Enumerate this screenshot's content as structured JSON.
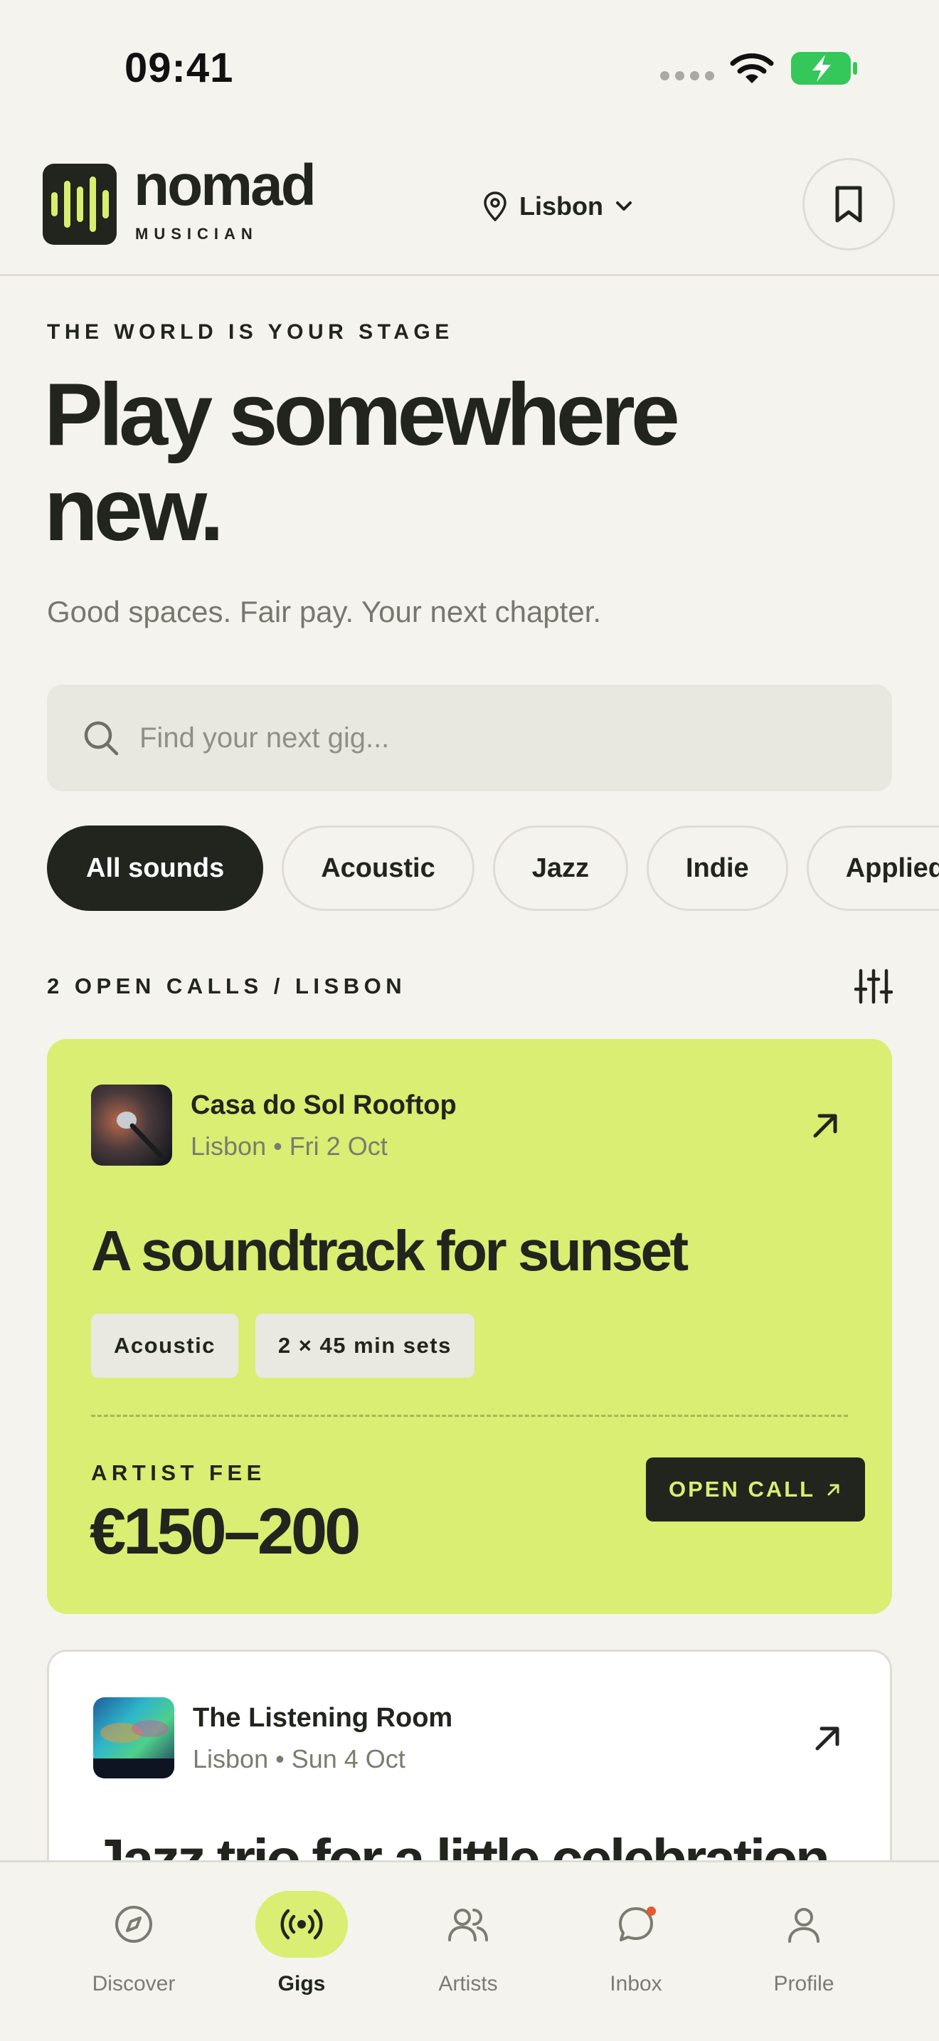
{
  "status_bar": {
    "time": "09:41"
  },
  "brand": {
    "name": "nomad",
    "subtitle": "MUSICIAN"
  },
  "location": {
    "city": "Lisbon"
  },
  "hero": {
    "eyebrow": "THE WORLD IS YOUR STAGE",
    "title": "Play somewhere new.",
    "subtitle": "Good spaces. Fair pay. Your next chapter."
  },
  "search": {
    "placeholder": "Find your next gig..."
  },
  "filters": [
    {
      "label": "All sounds",
      "active": true
    },
    {
      "label": "Acoustic",
      "active": false
    },
    {
      "label": "Jazz",
      "active": false
    },
    {
      "label": "Indie",
      "active": false
    },
    {
      "label": "Applied",
      "active": false
    }
  ],
  "list_header": "2 OPEN CALLS / LISBON",
  "gigs": [
    {
      "venue": "Casa do Sol Rooftop",
      "meta": "Lisbon • Fri 2 Oct",
      "title": "A soundtrack for sunset",
      "tags": [
        "Acoustic",
        "2 × 45 min sets"
      ],
      "fee_label": "ARTIST FEE",
      "fee": "€150–200",
      "cta": "OPEN CALL",
      "card_color": "#D9EE72"
    },
    {
      "venue": "The Listening Room",
      "meta": "Lisbon • Sun 4 Oct",
      "title": "Jazz trio for a little celebration",
      "card_color": "#FFFFFF"
    }
  ],
  "tabs": [
    {
      "label": "Discover",
      "icon": "compass-icon",
      "active": false
    },
    {
      "label": "Gigs",
      "icon": "broadcast-icon",
      "active": true
    },
    {
      "label": "Artists",
      "icon": "users-icon",
      "active": false
    },
    {
      "label": "Inbox",
      "icon": "chat-icon",
      "active": false,
      "badge": true
    },
    {
      "label": "Profile",
      "icon": "user-icon",
      "active": false
    }
  ],
  "colors": {
    "accent": "#D9EE72",
    "ink": "#22241E",
    "background": "#F4F3EE",
    "notification": "#E35A2B"
  }
}
